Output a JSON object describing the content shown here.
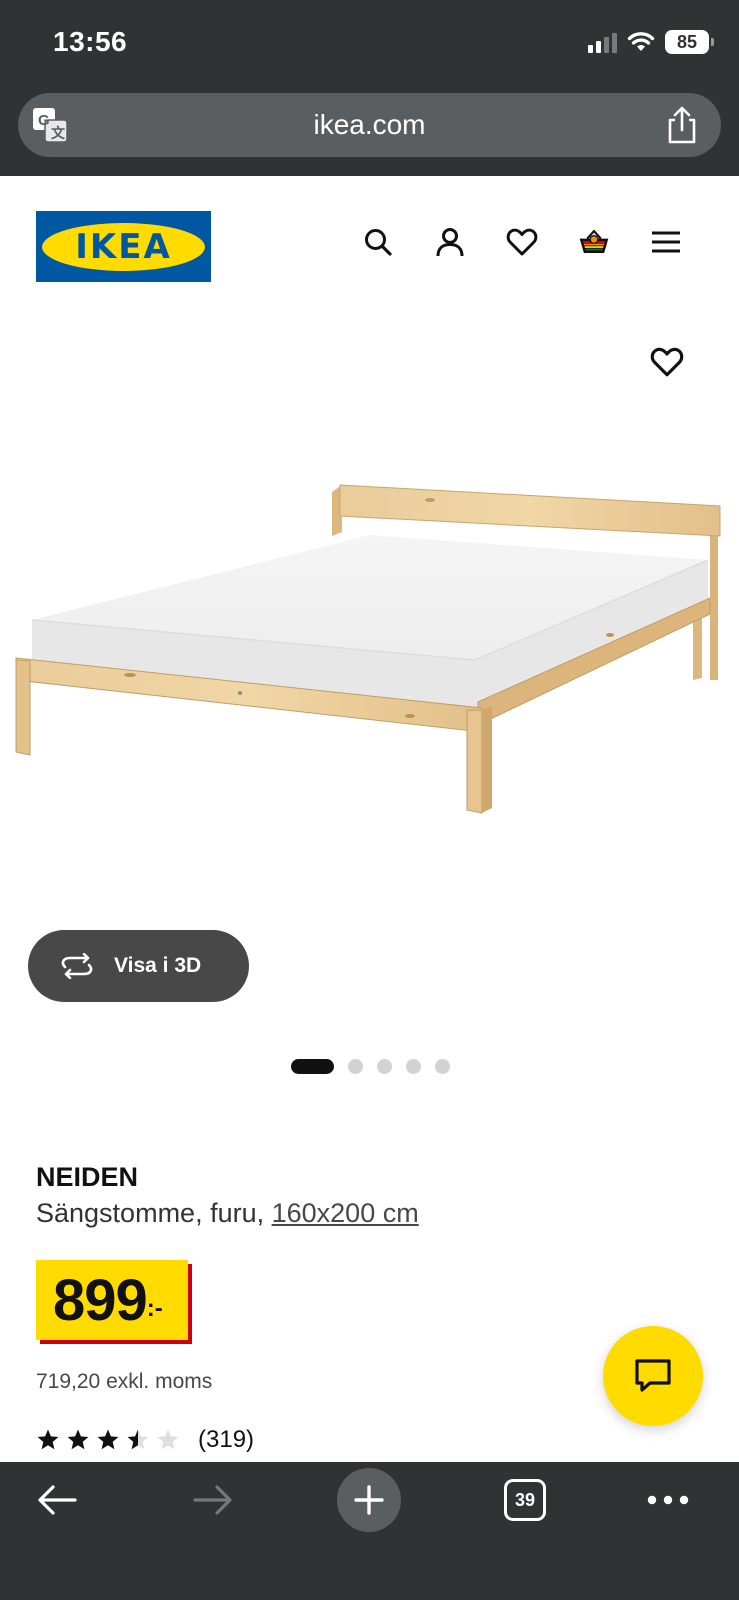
{
  "status_bar": {
    "time": "13:56",
    "battery": "85"
  },
  "url_bar": {
    "url": "ikea.com"
  },
  "site": {
    "logo_text": "IKEA",
    "brand_blue": "#0058a3",
    "brand_yellow": "#ffdb00"
  },
  "header_icons": [
    "search-icon",
    "account-icon",
    "heart-icon",
    "cart-icon",
    "menu-icon"
  ],
  "gallery": {
    "view_3d_label": "Visa i 3D",
    "image_count": 5,
    "active_image": 1
  },
  "product": {
    "name": "NEIDEN",
    "description": "Sängstomme, furu, ",
    "size_link": "160x200 cm",
    "price": "899",
    "price_suffix": ":-",
    "price_excl_vat": "719,20 exkl. moms",
    "rating": 3.5,
    "rating_max": 5,
    "review_count": "(319)"
  },
  "bottom_toolbar": {
    "tab_count": "39"
  }
}
